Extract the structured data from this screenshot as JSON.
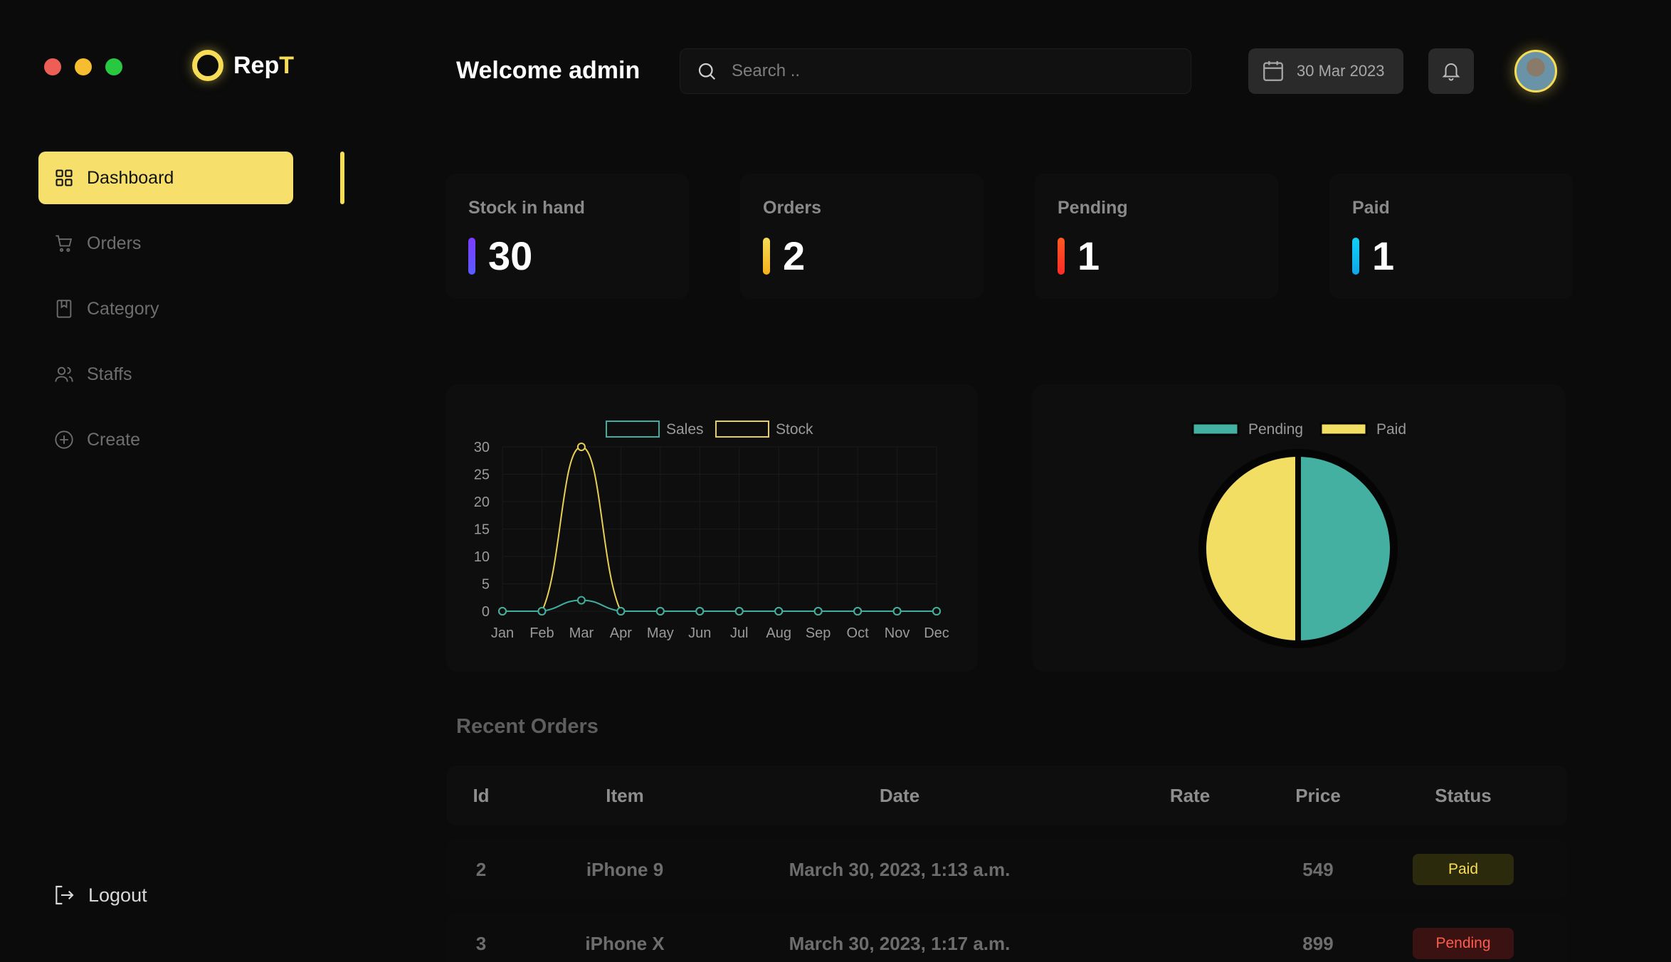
{
  "brand": {
    "name_prefix": "Rep",
    "name_suffix": "T"
  },
  "sidebar": {
    "items": [
      {
        "label": "Dashboard",
        "icon": "grid-icon",
        "active": true
      },
      {
        "label": "Orders",
        "icon": "cart-icon",
        "active": false
      },
      {
        "label": "Category",
        "icon": "bookmark-icon",
        "active": false
      },
      {
        "label": "Staffs",
        "icon": "users-icon",
        "active": false
      },
      {
        "label": "Create",
        "icon": "plus-circle-icon",
        "active": false
      }
    ],
    "logout_label": "Logout"
  },
  "header": {
    "welcome": "Welcome admin",
    "search_placeholder": "Search ..",
    "date": "30 Mar 2023"
  },
  "stats": [
    {
      "label": "Stock in hand",
      "value": "30",
      "color": "#7b3cff"
    },
    {
      "label": "Orders",
      "value": "2",
      "color": "#f6c71b"
    },
    {
      "label": "Pending",
      "value": "1",
      "color": "#ff3d1f"
    },
    {
      "label": "Paid",
      "value": "1",
      "color": "#11c5f0"
    }
  ],
  "chart_data": [
    {
      "type": "line",
      "categories": [
        "Jan",
        "Feb",
        "Mar",
        "Apr",
        "May",
        "Jun",
        "Jul",
        "Aug",
        "Sep",
        "Oct",
        "Nov",
        "Dec"
      ],
      "series": [
        {
          "name": "Sales",
          "color": "#3fae9f",
          "values": [
            0,
            0,
            2,
            0,
            0,
            0,
            0,
            0,
            0,
            0,
            0,
            0
          ]
        },
        {
          "name": "Stock",
          "color": "#e8cf55",
          "values": [
            0,
            0,
            30,
            0,
            0,
            0,
            0,
            0,
            0,
            0,
            0,
            0
          ]
        }
      ],
      "yticks": [
        "0",
        "5",
        "10",
        "15",
        "20",
        "25",
        "30"
      ],
      "ylim": [
        0,
        30
      ],
      "legend": "top",
      "grid": true
    },
    {
      "type": "pie",
      "labels": [
        "Pending",
        "Paid"
      ],
      "values": [
        1,
        1
      ],
      "colors": [
        "#44b0a2",
        "#f3de64"
      ],
      "legend": "top"
    }
  ],
  "recent_orders": {
    "title": "Recent Orders",
    "columns": [
      "Id",
      "Item",
      "Date",
      "Rate",
      "Price",
      "Status"
    ],
    "rows": [
      {
        "id": "2",
        "item": "iPhone 9",
        "date": "March 30, 2023, 1:13 a.m.",
        "rate": "",
        "price": "549",
        "status": "Paid"
      },
      {
        "id": "3",
        "item": "iPhone X",
        "date": "March 30, 2023, 1:17 a.m.",
        "rate": "",
        "price": "899",
        "status": "Pending"
      }
    ]
  }
}
